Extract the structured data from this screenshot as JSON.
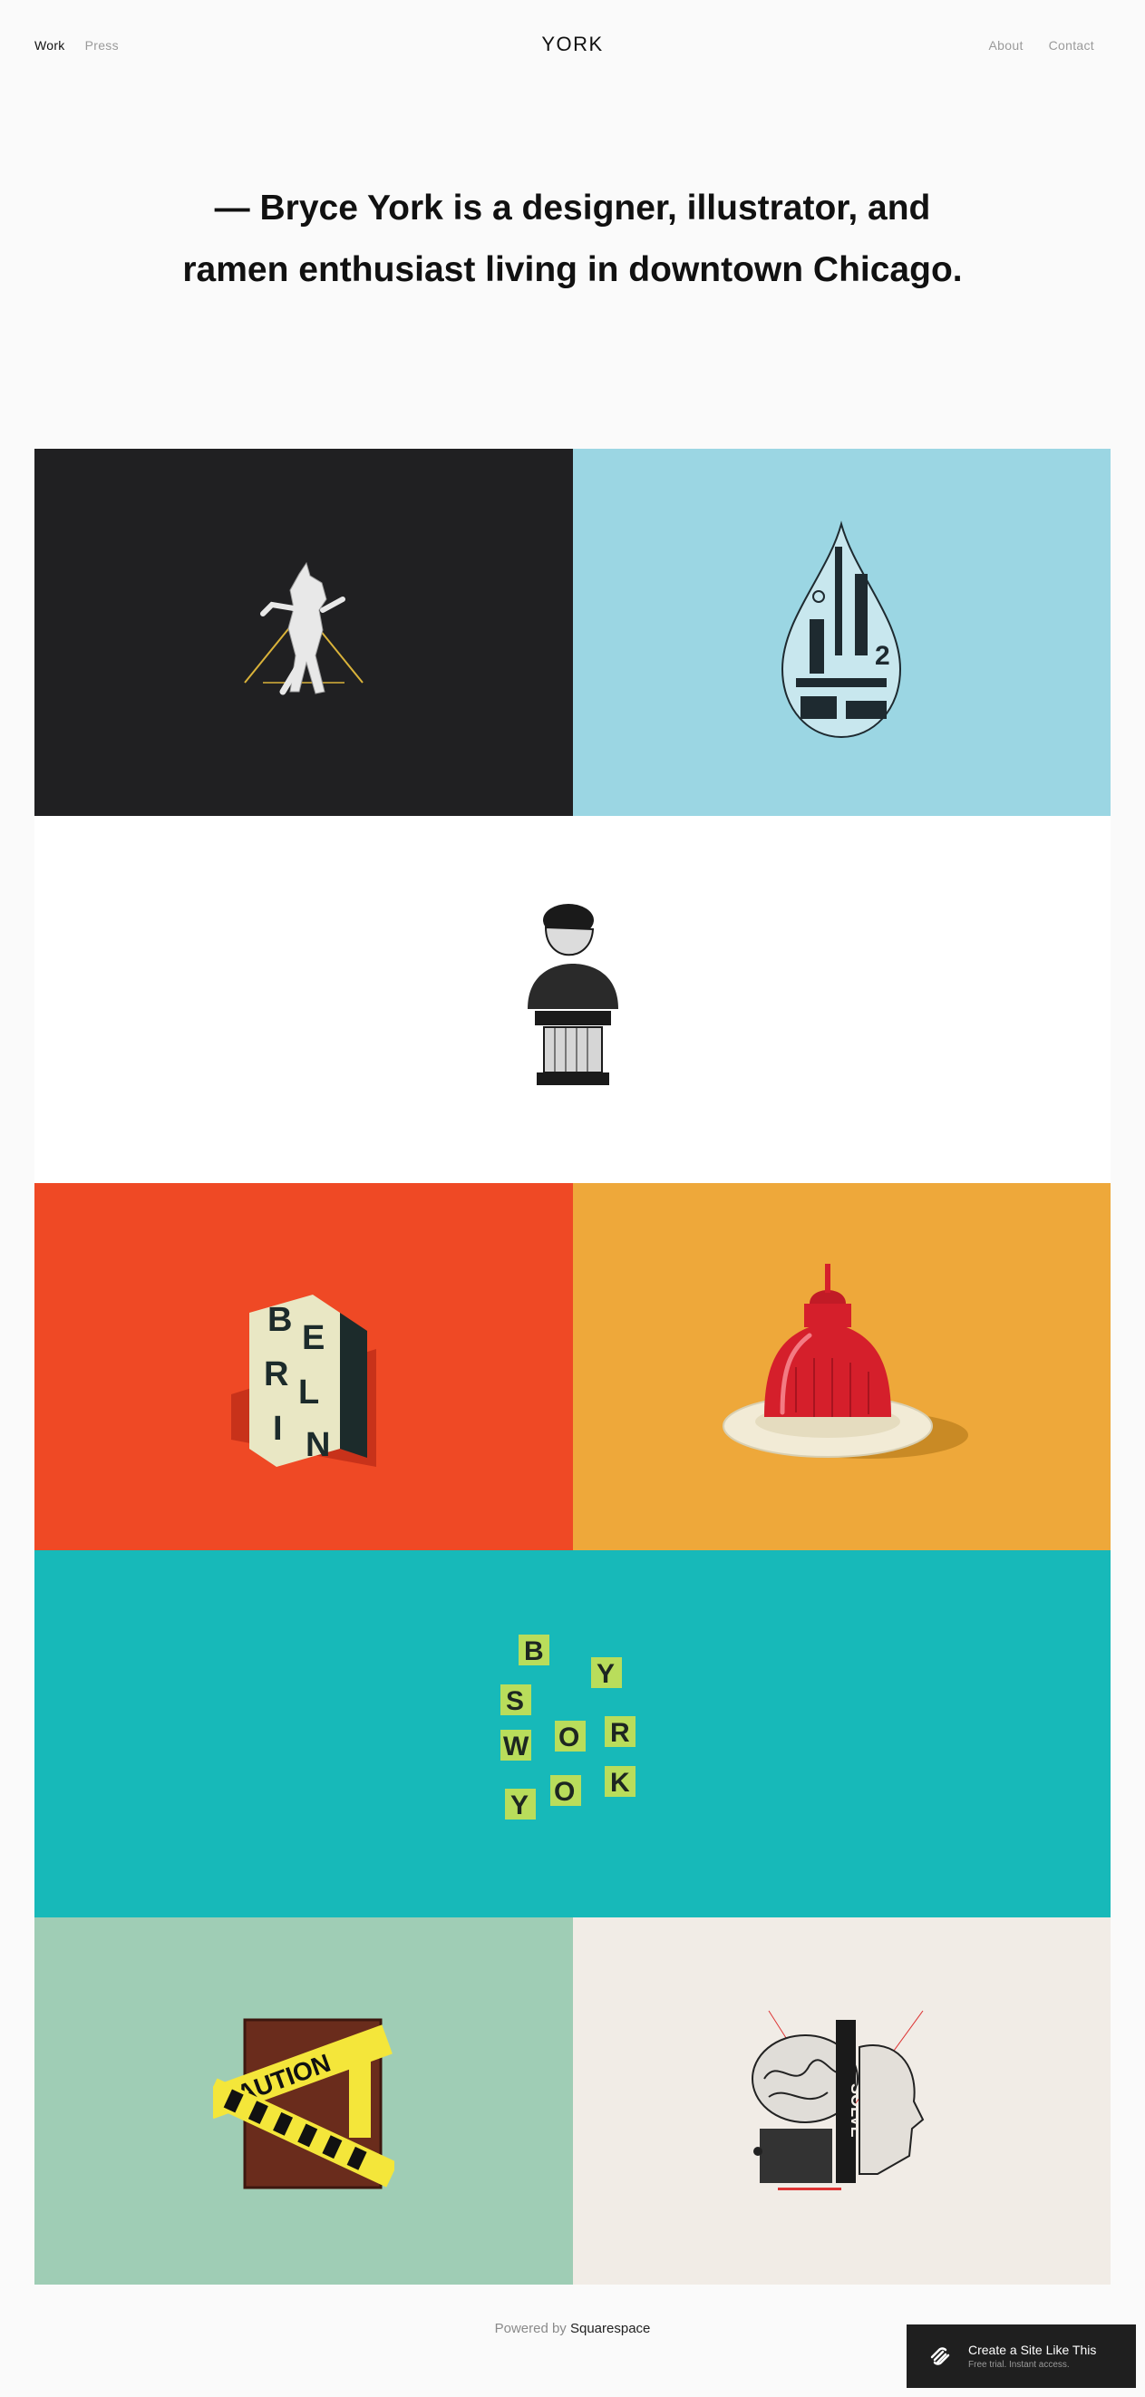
{
  "nav": {
    "left": [
      {
        "label": "Work"
      },
      {
        "label": "Press"
      }
    ],
    "logo": "YORK",
    "right": [
      {
        "label": "About"
      },
      {
        "label": "Contact"
      }
    ]
  },
  "intro": {
    "line1": "— Bryce York is a designer, illustrator, and",
    "line2": "ramen enthusiast living in downtown Chicago."
  },
  "projects": [
    {
      "name": "wolf-illustration",
      "bg": "#202022"
    },
    {
      "name": "city-drop-illustration",
      "bg": "#9bd6e3"
    },
    {
      "name": "bust-portrait-illustration",
      "bg": "#ffffff"
    },
    {
      "name": "berlin-type-illustration",
      "bg": "#ef4925"
    },
    {
      "name": "capitol-jello-illustration",
      "bg": "#eea83a"
    },
    {
      "name": "isometric-letters-illustration",
      "bg": "#17b9b9"
    },
    {
      "name": "caution-tape-book-illustration",
      "bg": "#9fcdb5"
    },
    {
      "name": "brain-solve-illustration",
      "bg": "#f1ece6"
    }
  ],
  "art": {
    "berlin": [
      "B",
      "E",
      "R",
      "L",
      "I",
      "N"
    ],
    "blocks": [
      "B",
      "Y",
      "S",
      "W",
      "O",
      "R",
      "K",
      "Y",
      "O"
    ],
    "caution": "CAUTION",
    "solve": "SOLVE",
    "number": "2"
  },
  "footer": {
    "prefix": "Powered by",
    "brand": "Squarespace"
  },
  "badge": {
    "title": "Create a Site Like This",
    "subtitle": "Free trial. Instant access."
  }
}
